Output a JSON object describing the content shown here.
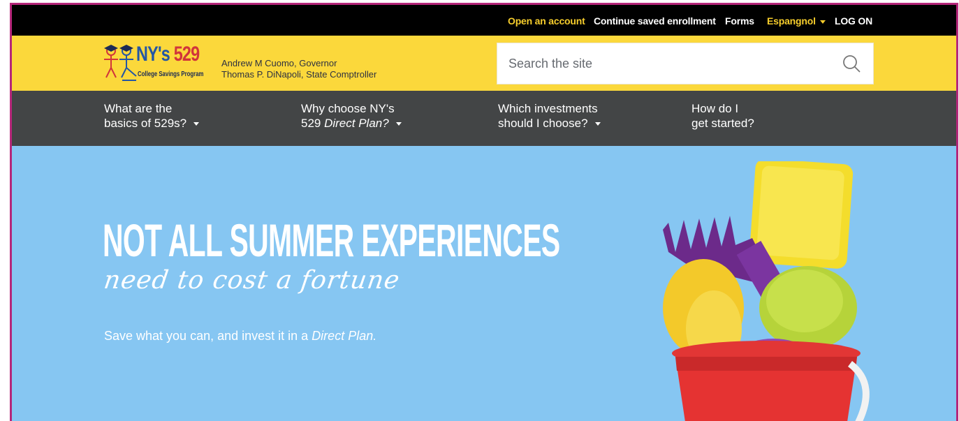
{
  "utility_nav": {
    "open_account": "Open an account",
    "continue_enrollment": "Continue saved enrollment",
    "forms": "Forms",
    "language": "Espangnol",
    "logon": "LOG ON"
  },
  "header": {
    "logo": {
      "title_ny": "NY's",
      "title_num": "529",
      "subtitle": "College Savings Program"
    },
    "officials": {
      "governor": "Andrew M Cuomo, Governor",
      "comptroller": "Thomas P. DiNapoli, State Comptroller"
    },
    "search": {
      "placeholder": "Search the site",
      "icon": "search-icon"
    }
  },
  "main_nav": [
    {
      "line1": "What are the",
      "line2": "basics of 529s?"
    },
    {
      "line1": "Why choose NY's",
      "line2_pre": "529 ",
      "line2_em": "Direct Plan?"
    },
    {
      "line1": "Which investments",
      "line2": "should I choose?"
    },
    {
      "line1": "How do I",
      "line2": "get started?"
    }
  ],
  "hero": {
    "headline": "NOT ALL SUMMER EXPERIENCES",
    "script": "need to cost a fortune",
    "sub_pre": "Save what you can, and invest it in a ",
    "sub_em": "Direct Plan."
  },
  "colors": {
    "utility_bg": "#000000",
    "utility_accent": "#f6cd2c",
    "header_bg": "#fbd83b",
    "nav_bg": "#434546",
    "hero_bg": "#86c6f2",
    "frame_border": "#b5277a"
  }
}
